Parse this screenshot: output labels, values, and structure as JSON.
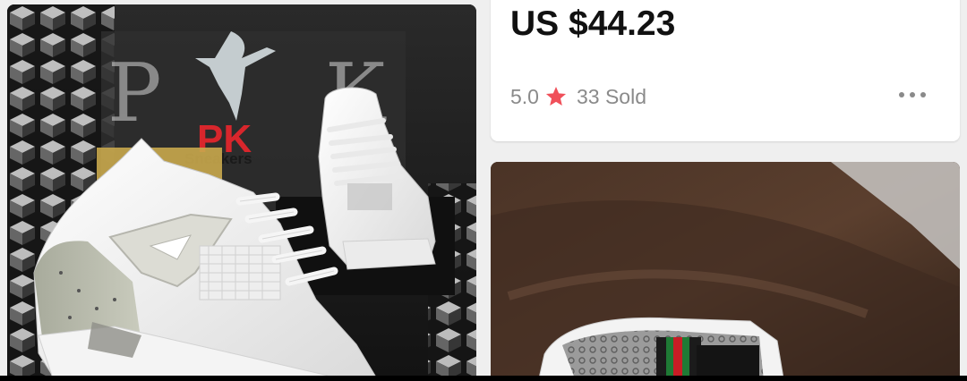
{
  "product": {
    "price": "US $44.23",
    "rating": "5.0",
    "sold": "33 Sold"
  },
  "left_image": {
    "brand_logo_text": "PK",
    "brand_subtext": "Sneakers",
    "background_letters": "P     K"
  },
  "icons": {
    "star": "star-icon",
    "more": "more-options-icon"
  },
  "colors": {
    "star": "#f0505a",
    "price_text": "#111111",
    "meta_text": "#8a8a8a",
    "logo_red": "#d8262c"
  }
}
